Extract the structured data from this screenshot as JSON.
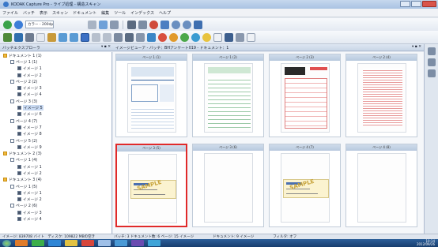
{
  "window": {
    "title": "KODAK Capture Pro - ライブ処理 - 構造スキャン"
  },
  "menu": [
    "ファイル",
    "バッチ",
    "表示",
    "スキャン",
    "ドキュメント",
    "編集",
    "ツール",
    "インデックス",
    "ヘルプ"
  ],
  "toolbar": {
    "profile_combo": "カラー - 200dpi"
  },
  "colors": {
    "selection_border": "#e02a2a",
    "titlebar": "#b4cbe8",
    "thumb_header": "#c4d3e5",
    "accent": "#3a78c9"
  },
  "tree": {
    "title": "バッチエクスプローラ",
    "controls": "▾ ▪ ✕",
    "nodes": [
      {
        "label": "ドキュメント 1 (1)",
        "kind": "doc",
        "level": 0
      },
      {
        "label": "ページ 1 (1)",
        "kind": "page",
        "level": 1
      },
      {
        "label": "イメージ 1",
        "kind": "img",
        "level": 2
      },
      {
        "label": "イメージ 2",
        "kind": "img",
        "level": 2
      },
      {
        "label": "ページ 2 (2)",
        "kind": "page",
        "level": 1
      },
      {
        "label": "イメージ 3",
        "kind": "img",
        "level": 2
      },
      {
        "label": "イメージ 4",
        "kind": "img",
        "level": 2
      },
      {
        "label": "ページ 3 (3)",
        "kind": "page",
        "level": 1
      },
      {
        "label": "イメージ 5",
        "kind": "img",
        "level": 2,
        "selected": true
      },
      {
        "label": "イメージ 6",
        "kind": "img",
        "level": 2
      },
      {
        "label": "ページ 4 (7)",
        "kind": "page",
        "level": 1
      },
      {
        "label": "イメージ 7",
        "kind": "img",
        "level": 2
      },
      {
        "label": "イメージ 8",
        "kind": "img",
        "level": 2
      },
      {
        "label": "ページ 5 (2)",
        "kind": "page",
        "level": 1
      },
      {
        "label": "イメージ 9",
        "kind": "img",
        "level": 2
      },
      {
        "label": "ドキュメント 2 (3)",
        "kind": "doc",
        "level": 0
      },
      {
        "label": "ページ 1 (4)",
        "kind": "page",
        "level": 1
      },
      {
        "label": "イメージ 1",
        "kind": "img",
        "level": 2
      },
      {
        "label": "イメージ 2",
        "kind": "img",
        "level": 2
      },
      {
        "label": "ドキュメント 3 (4)",
        "kind": "doc",
        "level": 0
      },
      {
        "label": "ページ 1 (5)",
        "kind": "page",
        "level": 1
      },
      {
        "label": "イメージ 1",
        "kind": "img",
        "level": 2
      },
      {
        "label": "イメージ 2",
        "kind": "img",
        "level": 2
      },
      {
        "label": "ページ 2 (6)",
        "kind": "page",
        "level": 1
      },
      {
        "label": "イメージ 3",
        "kind": "img",
        "level": 2
      },
      {
        "label": "イメージ 4",
        "kind": "img",
        "level": 2
      }
    ]
  },
  "viewer": {
    "title": "イメージビューア - バッチ：BHアンケート019 - ドキュメント：1",
    "controls": "▾ ▪ ✕",
    "thumbs": [
      {
        "header": "ページ 1 (1)",
        "type": "form-blue",
        "selected": false
      },
      {
        "header": "ページ 1 (2)",
        "type": "form-green",
        "selected": false
      },
      {
        "header": "ページ 2 (3)",
        "type": "form-red",
        "selected": false
      },
      {
        "header": "ページ 2 (4)",
        "type": "text-red",
        "selected": false
      },
      {
        "header": "ページ 3 (5)",
        "type": "check",
        "selected": true,
        "stamp": "SAMPLE"
      },
      {
        "header": "ページ 3 (6)",
        "type": "blank",
        "selected": false
      },
      {
        "header": "ページ 4 (7)",
        "type": "check",
        "selected": false,
        "stamp": "SAMPLE"
      },
      {
        "header": "ページ 4 (8)",
        "type": "blank",
        "selected": false
      }
    ]
  },
  "status": {
    "filesize": "イメージ: 839708 バイト　ディスク: 109822 MBの空き",
    "batch": "バッチ: 3 ドキュメント数: 6 ページ: 15 イメージ",
    "doc": "ドキュメント: 9 イメージ",
    "filter": "フィルタ: オフ"
  },
  "taskbar": {
    "clock_time": "10:14",
    "clock_date": "2012/09/26"
  }
}
